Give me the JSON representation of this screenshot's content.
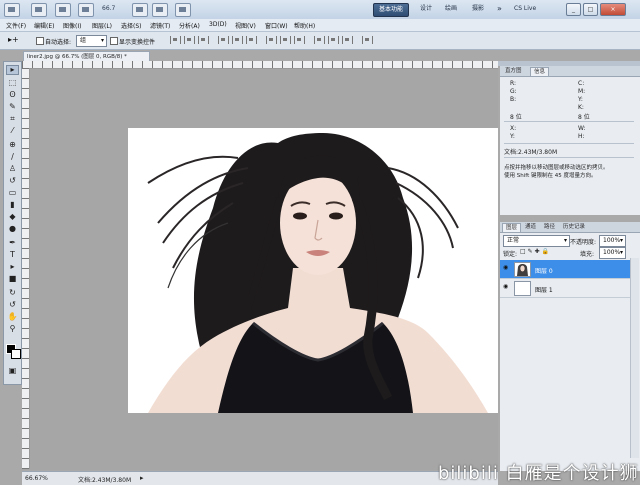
{
  "app": {
    "zoom_toolbar": "66.7",
    "workspaces": [
      "基本功能",
      "设计",
      "绘画",
      "摄影"
    ],
    "cs_live": "CS Live",
    "window_buttons": [
      "_",
      "□",
      "×"
    ]
  },
  "menu": [
    "文件(F)",
    "编辑(E)",
    "图像(I)",
    "图层(L)",
    "选择(S)",
    "滤镜(T)",
    "分析(A)",
    "3D(D)",
    "视图(V)",
    "窗口(W)",
    "帮助(H)"
  ],
  "options": {
    "auto_select_label": "自动选择:",
    "auto_select_value": "组",
    "show_transform_label": "显示变换控件"
  },
  "document": {
    "tab_title": "liner2.jpg @ 66.7% (图层 0, RGB/8) *",
    "status_zoom": "66.67%",
    "status_doc": "文档:2.43M/3.80M"
  },
  "info_panel": {
    "tabs": [
      "直方图",
      "信息"
    ],
    "rgb_labels": [
      "R:",
      "G:",
      "B:"
    ],
    "cmyk_labels": [
      "C:",
      "M:",
      "Y:",
      "K:"
    ],
    "bit_left": "8 位",
    "bit_right": "8 位",
    "xy_labels": [
      "X:",
      "Y:"
    ],
    "wh_labels": [
      "W:",
      "H:"
    ],
    "doc_size": "文档:2.43M/3.80M",
    "hint_line1": "点按并拖移以移动图层或移动选区的拷贝。",
    "hint_line2": "使用 Shift 键限制在 45 度增量方向。"
  },
  "layers_panel": {
    "tabs": [
      "图层",
      "通道",
      "路径",
      "历史记录"
    ],
    "blend_mode": "正常",
    "opacity_label": "不透明度:",
    "opacity_value": "100%",
    "lock_label": "锁定:",
    "fill_label": "填充:",
    "fill_value": "100%",
    "layers": [
      {
        "name": "图层 0",
        "selected": true
      },
      {
        "name": "图层 1",
        "selected": false
      }
    ]
  },
  "watermark": "bilibili 白雁是个设计狮",
  "colors": {
    "selected_layer": "#3d8ee8",
    "workspace_active": "#3b5b84",
    "canvas_bg": "#a6a6a6"
  }
}
